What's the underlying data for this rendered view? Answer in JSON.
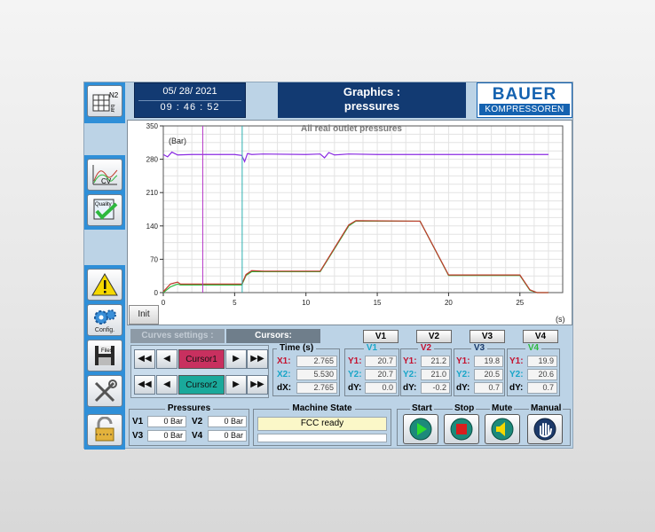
{
  "header": {
    "date": "05/ 28/ 2021",
    "time": "09 : 46 : 52",
    "title_line1": "Graphics :",
    "title_line2": "pressures",
    "logo_top": "BAUER",
    "logo_bottom": "KOMPRESSOREN"
  },
  "sidebar": {
    "n2_label": "N2",
    "bar_label": "bar",
    "cv_label": "CV",
    "quality_label": "Quality",
    "config_label": "Config.",
    "files_label": "Files"
  },
  "chart": {
    "title": "All real outlet pressures",
    "y_unit": "(Bar)",
    "x_unit": "(s)",
    "init_label": "Init"
  },
  "chart_data": {
    "type": "line",
    "title": "All real outlet pressures",
    "ylabel": "(Bar)",
    "xlabel": "(s)",
    "xlim": [
      0,
      28
    ],
    "ylim": [
      0,
      350
    ],
    "x_ticks": [
      0,
      5,
      10,
      15,
      20,
      25
    ],
    "y_ticks": [
      0,
      70,
      140,
      210,
      280,
      350
    ],
    "grid": true,
    "cursor1_x": 2.765,
    "cursor2_x": 5.53,
    "series": [
      {
        "color": "#8a2be2",
        "x": [
          0,
          0.3,
          0.6,
          1,
          2,
          3,
          4,
          5,
          5.5,
          5.7,
          5.9,
          6.2,
          7,
          10,
          11,
          11.3,
          11.6,
          12,
          13,
          15,
          20,
          25,
          27
        ],
        "y": [
          290,
          285,
          295,
          289,
          290,
          290,
          290,
          290,
          288,
          275,
          292,
          290,
          291,
          290,
          291,
          283,
          294,
          289,
          291,
          290,
          290,
          290,
          290
        ]
      },
      {
        "color": "#2db83d",
        "x": [
          0,
          0.5,
          1,
          1.2,
          2.8,
          5.5,
          5.8,
          6.2,
          7,
          11,
          13,
          13.5,
          18,
          20,
          25,
          25.7,
          26.2,
          27
        ],
        "y": [
          0,
          12,
          18,
          16,
          16,
          16,
          36,
          44,
          44,
          44,
          140,
          150,
          150,
          36,
          36,
          5,
          0,
          0
        ]
      },
      {
        "color": "#c0392b",
        "x": [
          0,
          0.5,
          1,
          1.2,
          2.8,
          5.5,
          5.8,
          6.2,
          7,
          11,
          13,
          13.5,
          18,
          20,
          25,
          25.7,
          26.2,
          27
        ],
        "y": [
          2,
          18,
          22,
          18,
          18,
          18,
          38,
          46,
          45,
          45,
          142,
          151,
          150,
          37,
          37,
          6,
          0,
          0
        ]
      }
    ]
  },
  "tabs": {
    "curves_settings": "Curves settings :",
    "cursors": "Cursors:"
  },
  "cursor_panel": {
    "cursor1": "Cursor1",
    "cursor2": "Cursor2"
  },
  "time_group": {
    "legend": "Time (s)",
    "x1_label": "X1:",
    "x1": "2.765",
    "x2_label": "X2:",
    "x2": "5.530",
    "dx_label": "dX:",
    "dx": "2.765"
  },
  "values": {
    "v1": {
      "btn": "V1",
      "legend": "V1",
      "y1": "20.7",
      "y2": "20.7",
      "dy": "0.0"
    },
    "v2": {
      "btn": "V2",
      "legend": "V2",
      "y1": "21.2",
      "y2": "21.0",
      "dy": "-0.2"
    },
    "v3": {
      "btn": "V3",
      "legend": "V3",
      "y1": "19.8",
      "y2": "20.5",
      "dy": "0.7"
    },
    "v4": {
      "btn": "V4",
      "legend": "V4",
      "y1": "19.9",
      "y2": "20.6",
      "dy": "0.7"
    },
    "y1_label": "Y1:",
    "y2_label": "Y2:",
    "dy_label": "dY:"
  },
  "pressures": {
    "legend": "Pressures",
    "v1_label": "V1",
    "v1": "0 Bar",
    "v2_label": "V2",
    "v2": "0 Bar",
    "v3_label": "V3",
    "v3": "0 Bar",
    "v4_label": "V4",
    "v4": "0 Bar"
  },
  "machine_state": {
    "legend": "Machine State",
    "status": "FCC ready",
    "secondary": ""
  },
  "controls": {
    "start": "Start",
    "stop": "Stop",
    "mute": "Mute",
    "manual": "Manual"
  },
  "colors": {
    "v1": "#1aa6c8",
    "v2": "#c4122f",
    "v3": "#1a3a6a",
    "v4": "#2db83d",
    "cursor1_bg": "#c8305f",
    "cursor2_bg": "#1aa99b",
    "cursor1_line": "#b536c6",
    "cursor2_line": "#2fb0b0"
  }
}
